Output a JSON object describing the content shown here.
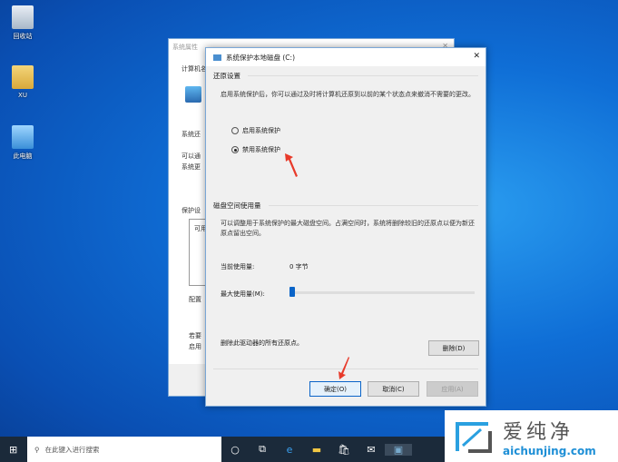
{
  "desktop": {
    "icons": [
      {
        "label": "回收站"
      },
      {
        "label": "XU"
      },
      {
        "label": "此电脑"
      }
    ]
  },
  "back_window": {
    "title": "系统属性",
    "tab": "计算机名",
    "texts": [
      "系统还",
      "可以通",
      "系统更",
      "保护设",
      "可用",
      "配置",
      "若要",
      "启用"
    ]
  },
  "dialog": {
    "title": "系统保护本地磁盘 (C:)",
    "restore_section": "还原设置",
    "restore_desc": "启用系统保护后，你可以通过及时将计算机还原到以前的某个状态点来撤消不需要的更改。",
    "radio_enable": "启用系统保护",
    "radio_disable": "禁用系统保护",
    "selected": "disable",
    "disk_section": "磁盘空间使用量",
    "disk_desc": "可以调整用于系统保护的最大磁盘空间。占满空间时，系统将删除较旧的还原点以便为新还原点留出空间。",
    "current_label": "当前使用量:",
    "current_value": "0 字节",
    "max_label": "最大使用量(M):",
    "slider_percent": 0,
    "delete_desc": "删除此驱动器的所有还原点。",
    "delete_btn": "删除(D)",
    "ok_btn": "确定(O)",
    "cancel_btn": "取消(C)",
    "apply_btn": "应用(A)"
  },
  "taskbar": {
    "search_placeholder": "在此键入进行搜索"
  },
  "watermark": {
    "brand": "爱纯净",
    "url": "aichunjing.com"
  }
}
